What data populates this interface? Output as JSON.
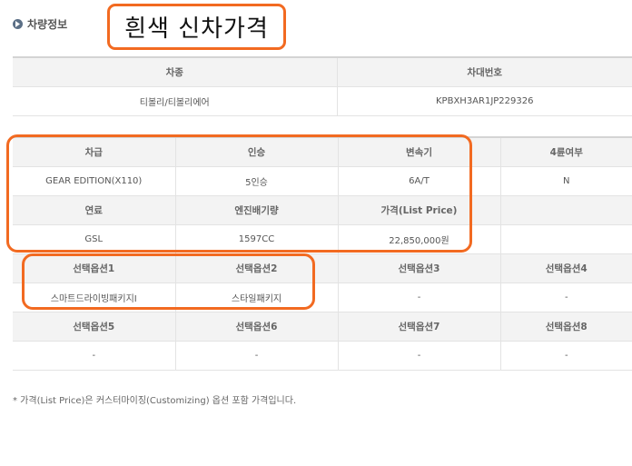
{
  "section": {
    "title": "차량정보"
  },
  "callout": {
    "text": "흰색 신차가격"
  },
  "table1": {
    "headers": [
      "차종",
      "차대번호"
    ],
    "values": [
      "티볼리/티볼리에어",
      "KPBXH3AR1JP229326"
    ]
  },
  "table2": {
    "row1_headers": [
      "차급",
      "인승",
      "변속기",
      "4륜여부"
    ],
    "row1_values": [
      "GEAR EDITION(X110)",
      "5인승",
      "6A/T",
      "N"
    ],
    "row2_headers": [
      "연료",
      "엔진배기량",
      "가격(List Price)",
      ""
    ],
    "row2_values": [
      "GSL",
      "1597CC",
      "22,850,000원",
      ""
    ],
    "row3_headers": [
      "선택옵션1",
      "선택옵션2",
      "선택옵션3",
      "선택옵션4"
    ],
    "row3_values": [
      "스마트드라이빙패키지I",
      "스타일패키지",
      "-",
      "-"
    ],
    "row4_headers": [
      "선택옵션5",
      "선택옵션6",
      "선택옵션7",
      "선택옵션8"
    ],
    "row4_values": [
      "-",
      "-",
      "-",
      "-"
    ]
  },
  "footnote": "* 가격(List Price)은 커스터마이징(Customizing) 옵션 포함 가격입니다.",
  "colors": {
    "highlight": "#f26a21",
    "header_bg": "#f3f3f3",
    "bullet": "#5b6f86"
  },
  "icons": {
    "section_bullet": "circle-arrow-right-icon"
  }
}
